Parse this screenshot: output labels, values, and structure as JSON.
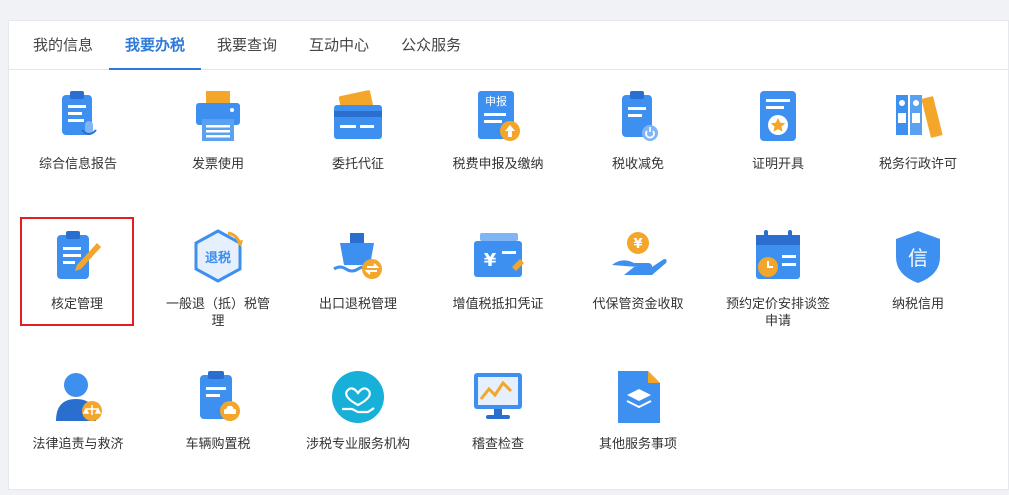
{
  "tabs": [
    {
      "label": "我的信息"
    },
    {
      "label": "我要办税"
    },
    {
      "label": "我要查询"
    },
    {
      "label": "互动中心"
    },
    {
      "label": "公众服务"
    }
  ],
  "active_tab": "我要办税",
  "items": [
    {
      "label": "综合信息报告",
      "icon": "clipboard-mic-icon"
    },
    {
      "label": "发票使用",
      "icon": "printer-icon"
    },
    {
      "label": "委托代征",
      "icon": "card-stack-icon"
    },
    {
      "label": "税费申报及缴纳",
      "icon": "declare-upload-icon"
    },
    {
      "label": "税收减免",
      "icon": "clipboard-power-icon"
    },
    {
      "label": "证明开具",
      "icon": "certificate-star-icon"
    },
    {
      "label": "税务行政许可",
      "icon": "binders-icon"
    },
    {
      "label": "核定管理",
      "icon": "clipboard-pencil-icon",
      "highlighted": true
    },
    {
      "label": "一般退（抵）税管理",
      "icon": "refund-tax-icon"
    },
    {
      "label": "出口退税管理",
      "icon": "ship-refund-icon"
    },
    {
      "label": "增值税抵扣凭证",
      "icon": "yuan-voucher-icon"
    },
    {
      "label": "代保管资金收取",
      "icon": "hand-coin-icon"
    },
    {
      "label": "预约定价安排谈签申请",
      "icon": "calendar-clock-icon"
    },
    {
      "label": "纳税信用",
      "icon": "credit-shield-icon"
    },
    {
      "label": "法律追责与救济",
      "icon": "judge-scale-icon"
    },
    {
      "label": "车辆购置税",
      "icon": "clipboard-car-icon"
    },
    {
      "label": "涉税专业服务机构",
      "icon": "heart-hand-icon"
    },
    {
      "label": "稽查检查",
      "icon": "monitor-chart-icon"
    },
    {
      "label": "其他服务事项",
      "icon": "document-layers-icon"
    }
  ],
  "colors": {
    "accent": "#2f7ad8",
    "highlight": "#e02020",
    "icon_blue": "#3d8ff0",
    "icon_orange": "#f4a62a"
  }
}
